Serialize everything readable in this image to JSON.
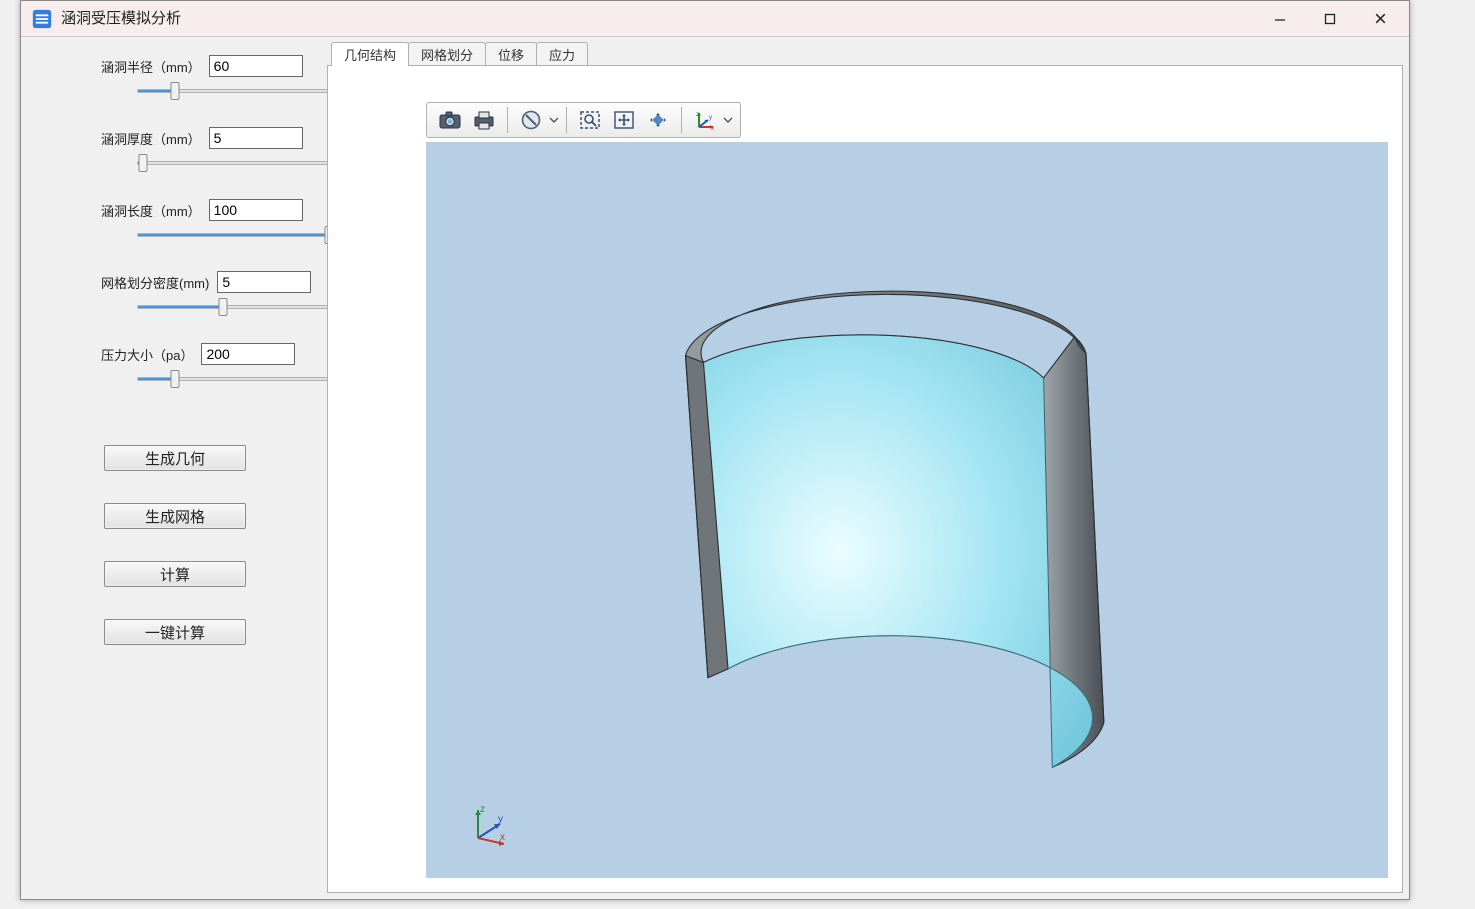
{
  "titlebar": {
    "title": "涵洞受压模拟分析"
  },
  "params": {
    "radius": {
      "label": "涵洞半径（mm）",
      "value": "60",
      "pct": 20
    },
    "thickness": {
      "label": "涵洞厚度（mm）",
      "value": "5",
      "pct": 3
    },
    "length": {
      "label": "涵洞长度（mm）",
      "value": "100",
      "pct": 100
    },
    "meshdens": {
      "label": "网格划分密度(mm)",
      "value": "5",
      "pct": 45
    },
    "pressure": {
      "label": "压力大小（pa）",
      "value": "200",
      "pct": 20
    }
  },
  "buttons": {
    "gen_geom": "生成几何",
    "gen_mesh": "生成网格",
    "compute": "计算",
    "quick": "一键计算"
  },
  "tabs": [
    {
      "id": "geom",
      "label": "几何结构",
      "active": true
    },
    {
      "id": "mesh",
      "label": "网格划分",
      "active": false
    },
    {
      "id": "disp",
      "label": "位移",
      "active": false
    },
    {
      "id": "stress",
      "label": "应力",
      "active": false
    }
  ],
  "toolbar_icons": {
    "snapshot": "camera-icon",
    "print": "print-icon",
    "info": "info-dropdown-icon",
    "zoom": "zoom-rect-icon",
    "pan": "pan-icon",
    "rotate": "rotate-icon",
    "axes": "axes-dropdown-icon"
  },
  "viewport_axes_labels": {
    "z": "z",
    "y": "y",
    "x": "x"
  }
}
